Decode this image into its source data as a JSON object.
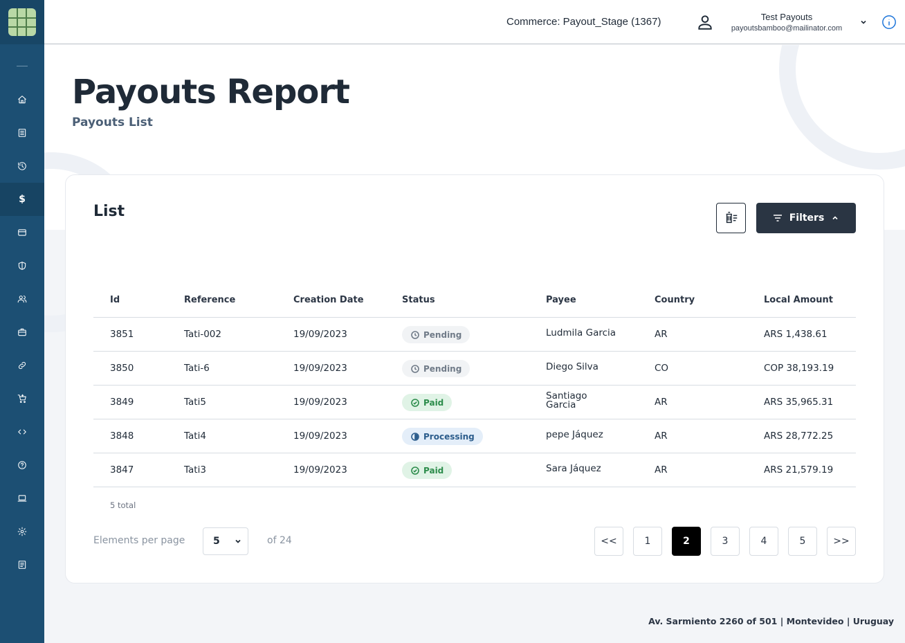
{
  "header": {
    "commerce": "Commerce: Payout_Stage (1367)",
    "user_name": "Test Payouts",
    "user_email": "payoutsbamboo@mailinator.com"
  },
  "sidebar": {
    "items": [
      {
        "icon": "home-icon"
      },
      {
        "icon": "list-icon"
      },
      {
        "icon": "history-icon"
      },
      {
        "icon": "dollar-icon",
        "glyph": "$"
      },
      {
        "icon": "card-icon"
      },
      {
        "icon": "shield-icon"
      },
      {
        "icon": "users-icon"
      },
      {
        "icon": "briefcase-icon"
      },
      {
        "icon": "link-icon"
      },
      {
        "icon": "cart-icon"
      },
      {
        "icon": "code-icon"
      },
      {
        "icon": "help-icon"
      },
      {
        "icon": "laptop-icon"
      },
      {
        "icon": "gear-icon"
      },
      {
        "icon": "report-icon"
      }
    ]
  },
  "page": {
    "title": "Payouts Report",
    "subtitle": "Payouts List"
  },
  "card": {
    "title": "List",
    "filters_label": "Filters"
  },
  "table": {
    "headers": [
      "Id",
      "Reference",
      "Creation Date",
      "Status",
      "Payee",
      "Country",
      "Local Amount"
    ],
    "rows": [
      {
        "id": "3851",
        "reference": "Tati-002",
        "date": "19/09/2023",
        "status": "Pending",
        "payee": "Ludmila Garcia",
        "country": "AR",
        "amount": "ARS 1,438.61"
      },
      {
        "id": "3850",
        "reference": "Tati-6",
        "date": "19/09/2023",
        "status": "Pending",
        "payee": "Diego Silva",
        "country": "CO",
        "amount": "COP 38,193.19"
      },
      {
        "id": "3849",
        "reference": "Tati5",
        "date": "19/09/2023",
        "status": "Paid",
        "payee": "Santiago Garcia",
        "country": "AR",
        "amount": "ARS 35,965.31"
      },
      {
        "id": "3848",
        "reference": "Tati4",
        "date": "19/09/2023",
        "status": "Processing",
        "payee": "pepe Jáquez",
        "country": "AR",
        "amount": "ARS 28,772.25"
      },
      {
        "id": "3847",
        "reference": "Tati3",
        "date": "19/09/2023",
        "status": "Paid",
        "payee": "Sara Jáquez",
        "country": "AR",
        "amount": "ARS 21,579.19"
      }
    ]
  },
  "pagination": {
    "total_label": "5 total",
    "per_page_label": "Elements per page",
    "per_page_value": "5",
    "of_total": "of 24",
    "first": "<<",
    "last": ">>",
    "pages": [
      "1",
      "2",
      "3",
      "4",
      "5"
    ],
    "current_page": "2"
  },
  "footer": {
    "address": "Av. Sarmiento 2260 of 501 | Montevideo | Uruguay"
  },
  "colors": {
    "sidebar": "#1c4f73",
    "primary_button": "#2a3543",
    "paid": "#2c8c4b",
    "pending": "#707b88",
    "processing": "#2c5d8c"
  }
}
